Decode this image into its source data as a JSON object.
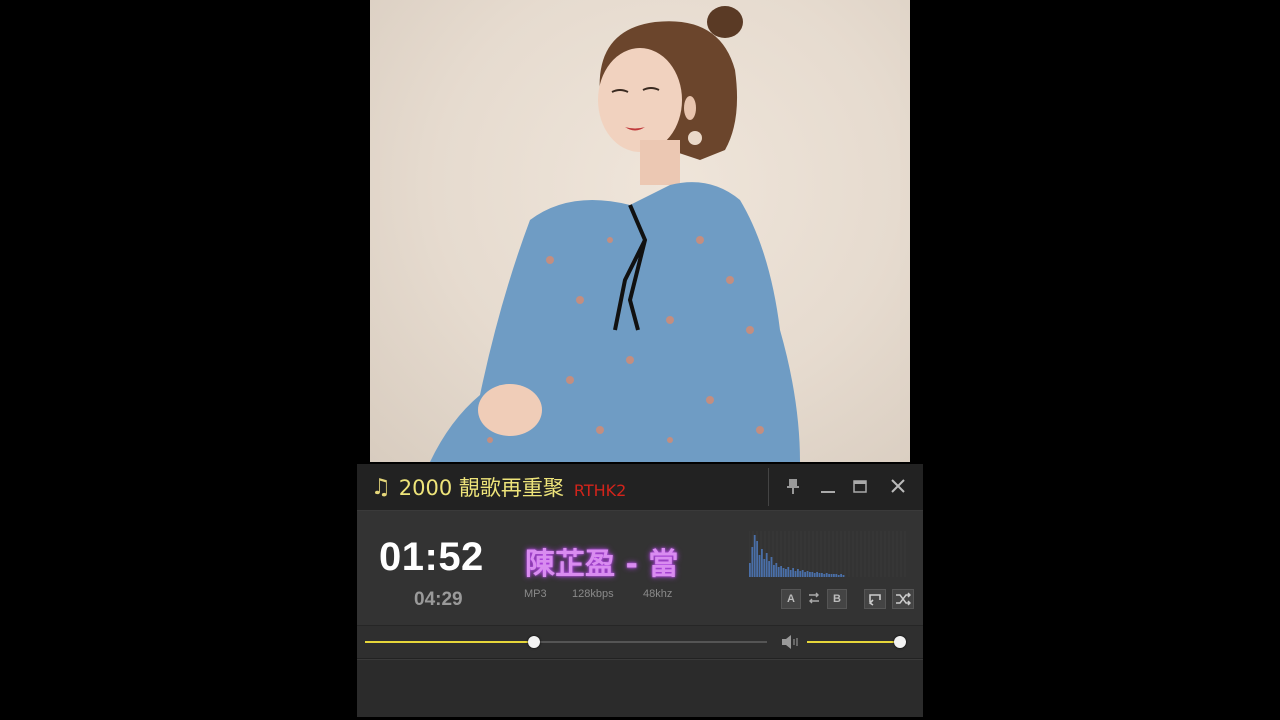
{
  "photo": {
    "alt_icon": "artist-photo"
  },
  "player": {
    "title_icon": "music-note-icon",
    "title_note": "♫",
    "title": "2000 靚歌再重聚",
    "station": "RTHK2",
    "buttons": {
      "pin": "pin-icon",
      "minimize": "minimize-icon",
      "maximize": "maximize-icon",
      "close": "close-icon"
    },
    "time_current": "01:52",
    "time_total": "04:29",
    "song": "陳芷盈 - 當",
    "format": "MP3",
    "bitrate": "128kbps",
    "samplerate": "48khz",
    "controls": {
      "a": "A",
      "b": "B"
    },
    "seek_progress": 0.42,
    "volume_level": 0.98,
    "colors": {
      "title": "#eee47a",
      "station": "#d2241b",
      "song": "#d98cf0",
      "accent": "#e6d63a",
      "spectrum": "#4a6fa8"
    }
  }
}
